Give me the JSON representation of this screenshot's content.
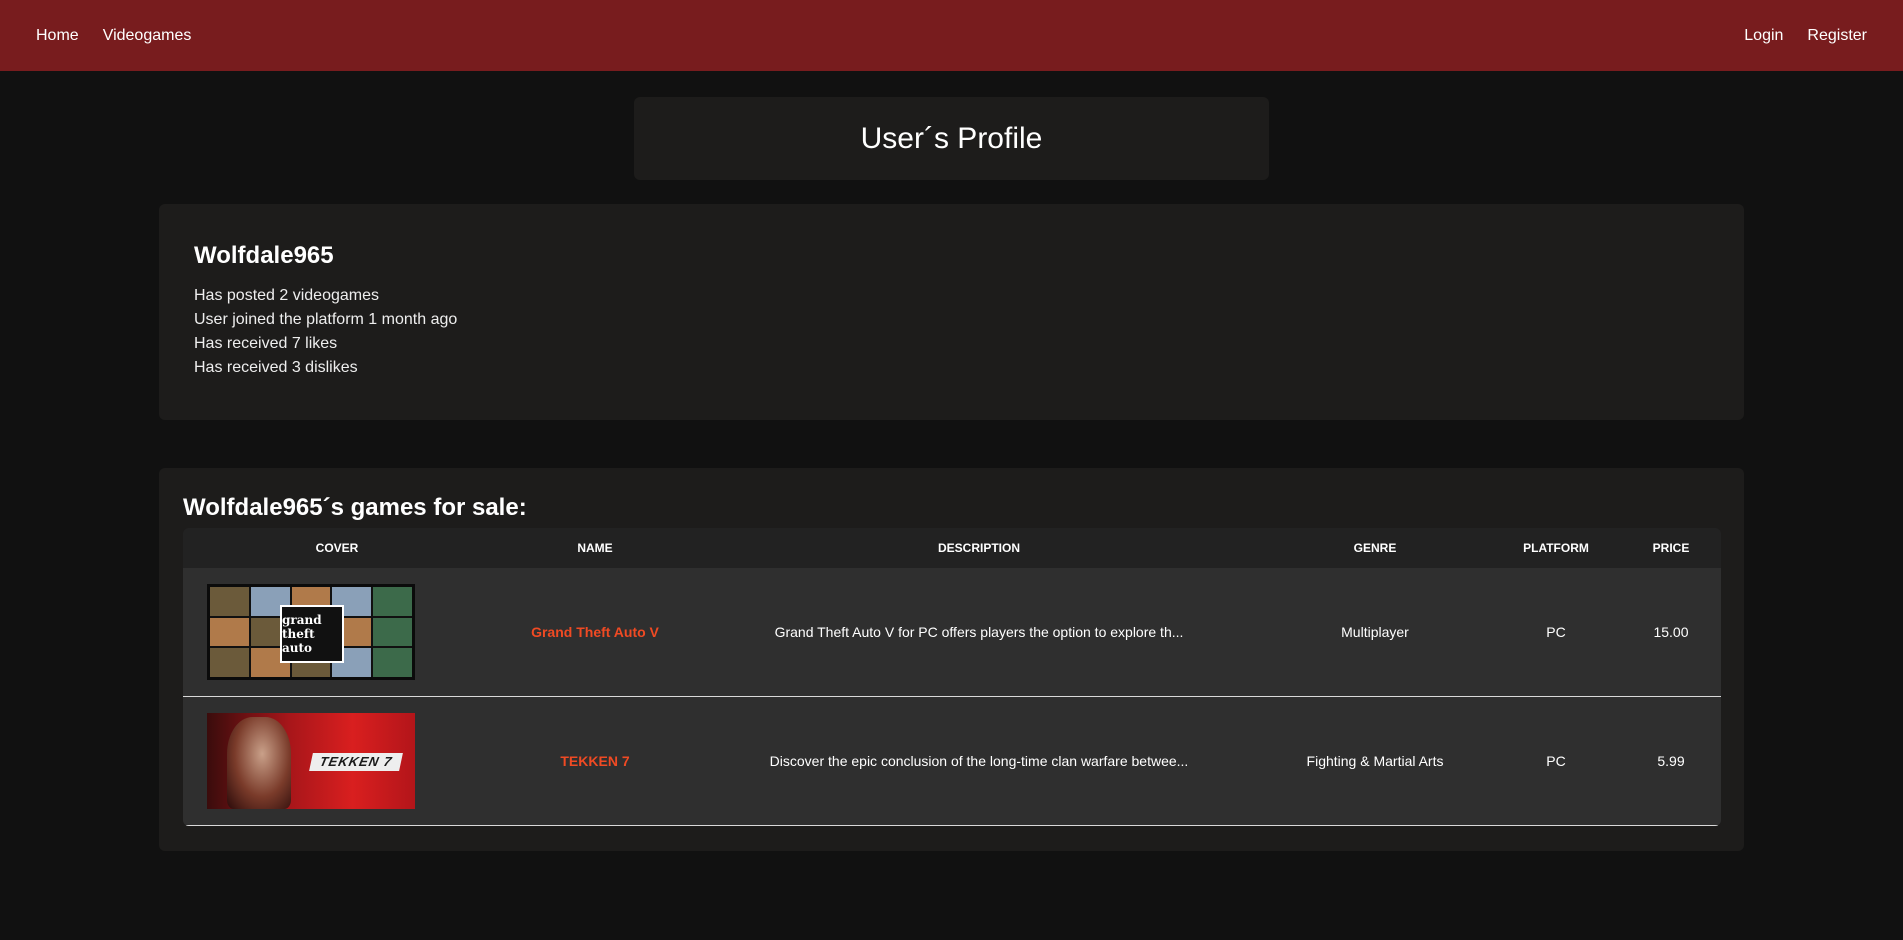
{
  "nav": {
    "left": [
      "Home",
      "Videogames"
    ],
    "right": [
      "Login",
      "Register"
    ]
  },
  "page_title": "User´s Profile",
  "profile": {
    "username": "Wolfdale965",
    "stats": [
      "Has posted 2 videogames",
      "User joined the platform 1 month ago",
      "Has received 7 likes",
      "Has received 3 dislikes"
    ]
  },
  "games_section": {
    "title": "Wolfdale965´s games for sale:",
    "columns": [
      "COVER",
      "NAME",
      "DESCRIPTION",
      "GENRE",
      "PLATFORM",
      "PRICE"
    ],
    "rows": [
      {
        "cover_logo": "grand theft auto",
        "name": "Grand Theft Auto V",
        "description": "Grand Theft Auto V for PC offers players the option to explore th...",
        "genre": "Multiplayer",
        "platform": "PC",
        "price": "15.00"
      },
      {
        "cover_logo": "TEKKEN 7",
        "name": "TEKKEN 7",
        "description": "Discover the epic conclusion of the long-time clan warfare betwee...",
        "genre": "Fighting & Martial Arts",
        "platform": "PC",
        "price": "5.99"
      }
    ]
  },
  "colors": {
    "navbar": "#781c1e",
    "background": "#111111",
    "card": "#1d1c1b",
    "row": "#2f2f2f",
    "accent_link": "#f04a23"
  }
}
